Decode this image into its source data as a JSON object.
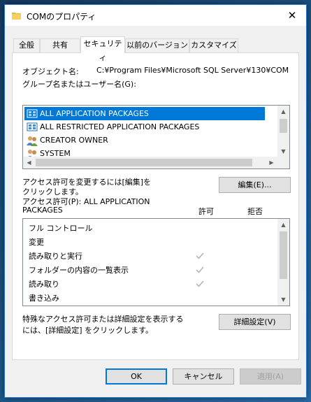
{
  "window": {
    "title": "COMのプロパティ",
    "close_label": "✕"
  },
  "tabs": [
    {
      "label": "全般"
    },
    {
      "label": "共有"
    },
    {
      "label": "セキュリティ"
    },
    {
      "label": "以前のバージョン"
    },
    {
      "label": "カスタマイズ"
    }
  ],
  "security": {
    "object_name_label": "オブジェクト名:",
    "object_name_value": "C:¥Program Files¥Microsoft SQL Server¥130¥COM",
    "group_label": "グループ名またはユーザー名(G):",
    "principals": [
      {
        "name": "ALL APPLICATION PACKAGES",
        "icon": "app-packages-icon",
        "selected": true
      },
      {
        "name": "ALL RESTRICTED APPLICATION PACKAGES",
        "icon": "app-packages-icon",
        "selected": false
      },
      {
        "name": "CREATOR OWNER",
        "icon": "users-icon",
        "selected": false
      },
      {
        "name": "SYSTEM",
        "icon": "users-icon",
        "selected": false
      }
    ],
    "edit_hint_line1": "アクセス許可を変更するには[編集]を",
    "edit_hint_line2": "クリックします。",
    "edit_button": "編集(E)...",
    "permissions_label_line1": "アクセス許可(P): ALL APPLICATION",
    "permissions_label_line2": "PACKAGES",
    "allow_header": "許可",
    "deny_header": "拒否",
    "permissions": [
      {
        "name": "フル コントロール",
        "allow": false,
        "deny": false
      },
      {
        "name": "変更",
        "allow": false,
        "deny": false
      },
      {
        "name": "読み取りと実行",
        "allow": true,
        "deny": false
      },
      {
        "name": "フォルダーの内容の一覧表示",
        "allow": true,
        "deny": false
      },
      {
        "name": "読み取り",
        "allow": true,
        "deny": false
      },
      {
        "name": "書き込み",
        "allow": false,
        "deny": false
      }
    ],
    "advanced_hint_line1": "特殊なアクセス許可または詳細設定を表示する",
    "advanced_hint_line2": "には、[詳細設定] をクリックします。",
    "advanced_button": "詳細設定(V)"
  },
  "footer": {
    "ok": "OK",
    "cancel": "キャンセル",
    "apply": "適用(A)"
  },
  "colors": {
    "selection": "#0078d7",
    "check": "#b4b4b4",
    "window_border": "#2b7bd0"
  }
}
